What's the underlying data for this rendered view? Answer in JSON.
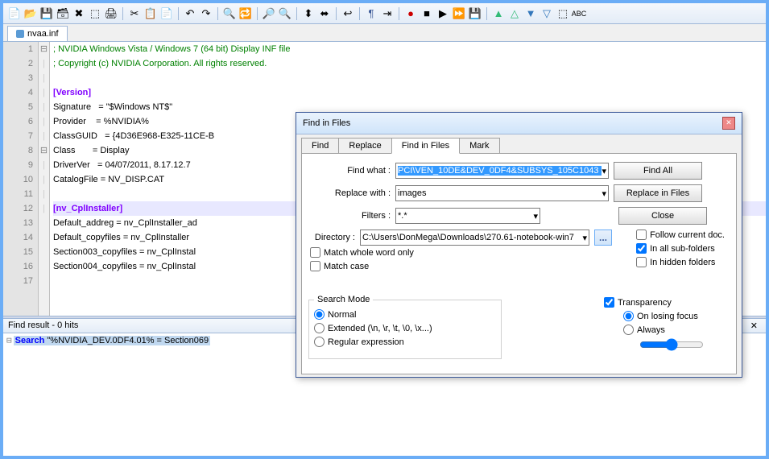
{
  "tab": {
    "filename": "nvaa.inf"
  },
  "code": {
    "lines": [
      "; NVIDIA Windows Vista / Windows 7 (64 bit) Display INF file",
      "; Copyright (c) NVIDIA Corporation. All rights reserved.",
      "",
      "[Version]",
      "Signature   = \"$Windows NT$\"",
      "Provider    = %NVIDIA%",
      "ClassGUID   = {4D36E968-E325-11CE-B",
      "Class       = Display",
      "DriverVer   = 04/07/2011, 8.17.12.7",
      "CatalogFile = NV_DISP.CAT",
      "",
      "[nv_CplInstaller]",
      "Default_addreg = nv_CplInstaller_ad",
      "Default_copyfiles = nv_CplInstaller",
      "Section003_copyfiles = nv_CplInstal",
      "Section004_copyfiles = nv_CplInstal",
      ""
    ]
  },
  "findresult": {
    "header": "Find result - 0 hits",
    "line": "Search \"%NVIDIA_DEV.0DF4.01% = Section069"
  },
  "dialog": {
    "title": "Find in Files",
    "tabs": [
      "Find",
      "Replace",
      "Find in Files",
      "Mark"
    ],
    "findwhat_label": "Find what :",
    "findwhat_value": "PCI\\VEN_10DE&DEV_0DF4&SUBSYS_105C1043",
    "replacewith_label": "Replace with :",
    "replacewith_value": "images",
    "filters_label": "Filters :",
    "filters_value": "*.*",
    "directory_label": "Directory :",
    "directory_value": "C:\\Users\\DonMega\\Downloads\\270.61-notebook-win7",
    "btn_findall": "Find All",
    "btn_replace": "Replace in Files",
    "btn_close": "Close",
    "chk_wholeword": "Match whole word only",
    "chk_matchcase": "Match case",
    "chk_followdoc": "Follow current doc.",
    "chk_subfolders": "In all sub-folders",
    "chk_hidden": "In hidden folders",
    "searchmode_legend": "Search Mode",
    "sm_normal": "Normal",
    "sm_extended": "Extended (\\n, \\r, \\t, \\0, \\x...)",
    "sm_regex": "Regular expression",
    "transparency_label": "Transparency",
    "tr_losing": "On losing focus",
    "tr_always": "Always"
  }
}
